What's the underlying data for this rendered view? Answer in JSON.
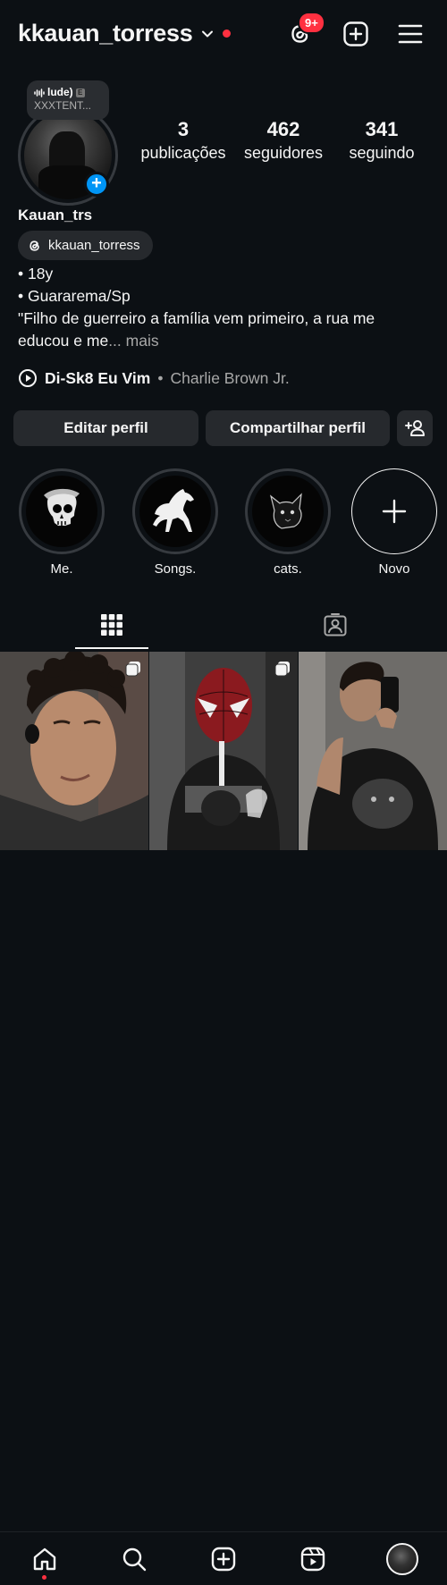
{
  "header": {
    "username": "kkauan_torress",
    "notification_badge": "9+",
    "colors": {
      "badge": "#ff3040",
      "accent": "#0095f6"
    }
  },
  "profile": {
    "note": {
      "title": "lude)",
      "subtitle": "XXXTENT..."
    },
    "stats": [
      {
        "value": "3",
        "label": "publicações"
      },
      {
        "value": "462",
        "label": "seguidores"
      },
      {
        "value": "341",
        "label": "seguindo"
      }
    ],
    "display_name": "Kauan_trs",
    "threads_handle": "kkauan_torress",
    "bio": {
      "line1": "• 18y",
      "line2": "• Guararema/Sp",
      "line3": "\"Filho de guerreiro a família vem primeiro, a rua me",
      "line4": "educou e me",
      "ellipsis": "...",
      "more": "mais"
    },
    "music": {
      "song": "Di-Sk8 Eu Vim",
      "separator": "•",
      "artist": "Charlie Brown Jr."
    }
  },
  "buttons": {
    "edit": "Editar perfil",
    "share": "Compartilhar perfil"
  },
  "highlights": [
    {
      "label": "Me."
    },
    {
      "label": "Songs."
    },
    {
      "label": "cats."
    },
    {
      "label": "Novo"
    }
  ],
  "bottom_nav": [
    "home-icon",
    "search-icon",
    "create-icon",
    "reels-icon",
    "profile-avatar"
  ]
}
